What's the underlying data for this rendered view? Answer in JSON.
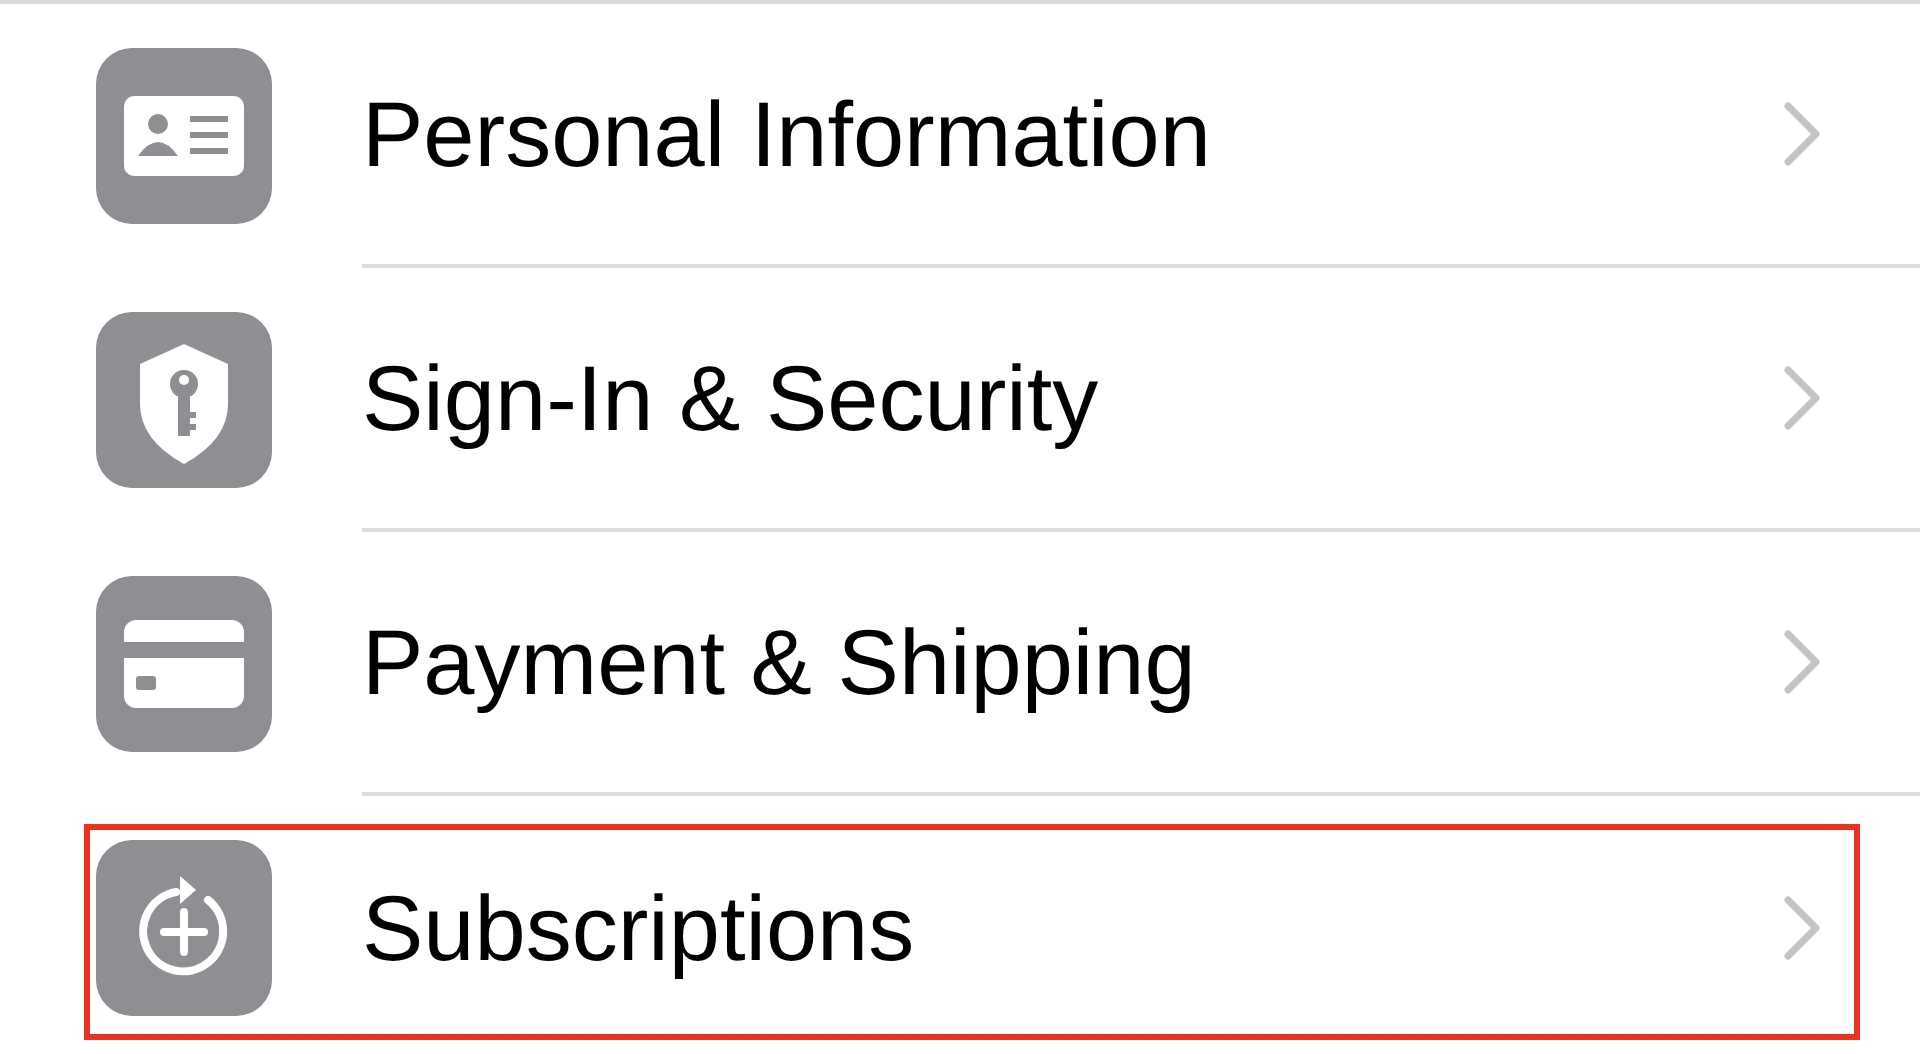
{
  "rows": [
    {
      "label": "Personal Information",
      "highlighted": false
    },
    {
      "label": "Sign-In & Security",
      "highlighted": false
    },
    {
      "label": "Payment & Shipping",
      "highlighted": false
    },
    {
      "label": "Subscriptions",
      "highlighted": true
    }
  ]
}
